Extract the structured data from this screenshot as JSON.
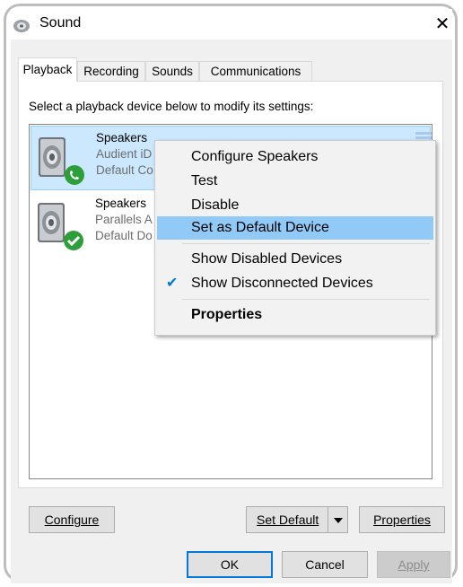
{
  "window": {
    "title": "Sound",
    "close_symbol": "✕",
    "icon": "speaker-icon"
  },
  "tabs": [
    {
      "label": "Playback",
      "active": true
    },
    {
      "label": "Recording",
      "active": false
    },
    {
      "label": "Sounds",
      "active": false
    },
    {
      "label": "Communications",
      "active": false
    }
  ],
  "instruction": "Select a playback device below to modify its settings:",
  "devices": [
    {
      "name": "Speakers",
      "line2": "Audient iD",
      "line3": "Default Co",
      "status_icon": "phone-badge-icon",
      "selected": true
    },
    {
      "name": "Speakers",
      "line2": "Parallels A",
      "line3": "Default Do",
      "status_icon": "checkmark-badge-icon",
      "selected": false
    }
  ],
  "buttons": {
    "configure_label": "Configure",
    "set_default_label": "Set Default",
    "properties_label": "Properties",
    "ok_label": "OK",
    "cancel_label": "Cancel",
    "apply_label": "Apply"
  },
  "context_menu": {
    "items": [
      {
        "label": "Configure Speakers"
      },
      {
        "label": "Test"
      },
      {
        "label": "Disable"
      },
      {
        "label": "Set as Default Device",
        "highlighted": true
      },
      {
        "label": "Show Disabled Devices"
      },
      {
        "label": "Show Disconnected Devices",
        "checked": true
      },
      {
        "label": "Properties",
        "bold": true
      }
    ]
  },
  "colors": {
    "selection": "#cce8ff",
    "menu_highlight": "#91c9f7",
    "badge_green": "#2e9e3b",
    "primary_border": "#0078d7"
  }
}
